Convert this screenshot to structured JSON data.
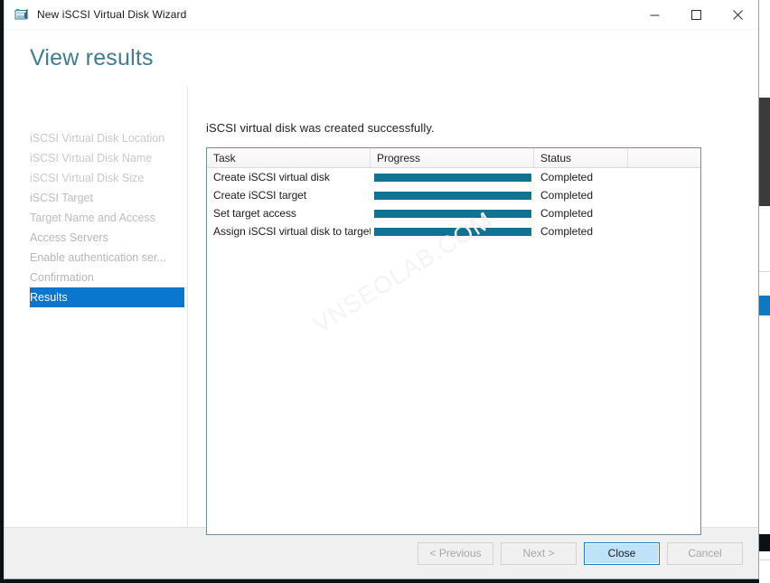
{
  "window": {
    "title": "New iSCSI Virtual Disk Wizard",
    "icon": "wizard-disk-icon",
    "controls": {
      "minimize": "minimize-icon",
      "maximize": "maximize-icon",
      "close": "close-icon"
    }
  },
  "header": {
    "title": "View results",
    "accent_color": "#3f7d8f"
  },
  "sidebar": {
    "items": [
      {
        "label": "iSCSI Virtual Disk Location",
        "state": "done"
      },
      {
        "label": "iSCSI Virtual Disk Name",
        "state": "done"
      },
      {
        "label": "iSCSI Virtual Disk Size",
        "state": "done"
      },
      {
        "label": "iSCSI Target",
        "state": "done"
      },
      {
        "label": "Target Name and Access",
        "state": "done"
      },
      {
        "label": "Access Servers",
        "state": "done"
      },
      {
        "label": "Enable authentication ser...",
        "state": "done"
      },
      {
        "label": "Confirmation",
        "state": "done"
      },
      {
        "label": "Results",
        "state": "selected"
      }
    ],
    "selected_bg": "#0a76ce"
  },
  "content": {
    "message": "iSCSI virtual disk was created successfully.",
    "watermark": "VNSEOLAB.COM",
    "table": {
      "columns": [
        "Task",
        "Progress",
        "Status",
        ""
      ],
      "rows": [
        {
          "task": "Create iSCSI virtual disk",
          "progress": 100,
          "status": "Completed"
        },
        {
          "task": "Create iSCSI target",
          "progress": 100,
          "status": "Completed"
        },
        {
          "task": "Set target access",
          "progress": 100,
          "status": "Completed"
        },
        {
          "task": "Assign iSCSI virtual disk to target",
          "progress": 100,
          "status": "Completed"
        }
      ],
      "progress_color": "#0f7391"
    }
  },
  "footer": {
    "previous_label": "< Previous",
    "next_label": "Next >",
    "close_label": "Close",
    "cancel_label": "Cancel"
  }
}
